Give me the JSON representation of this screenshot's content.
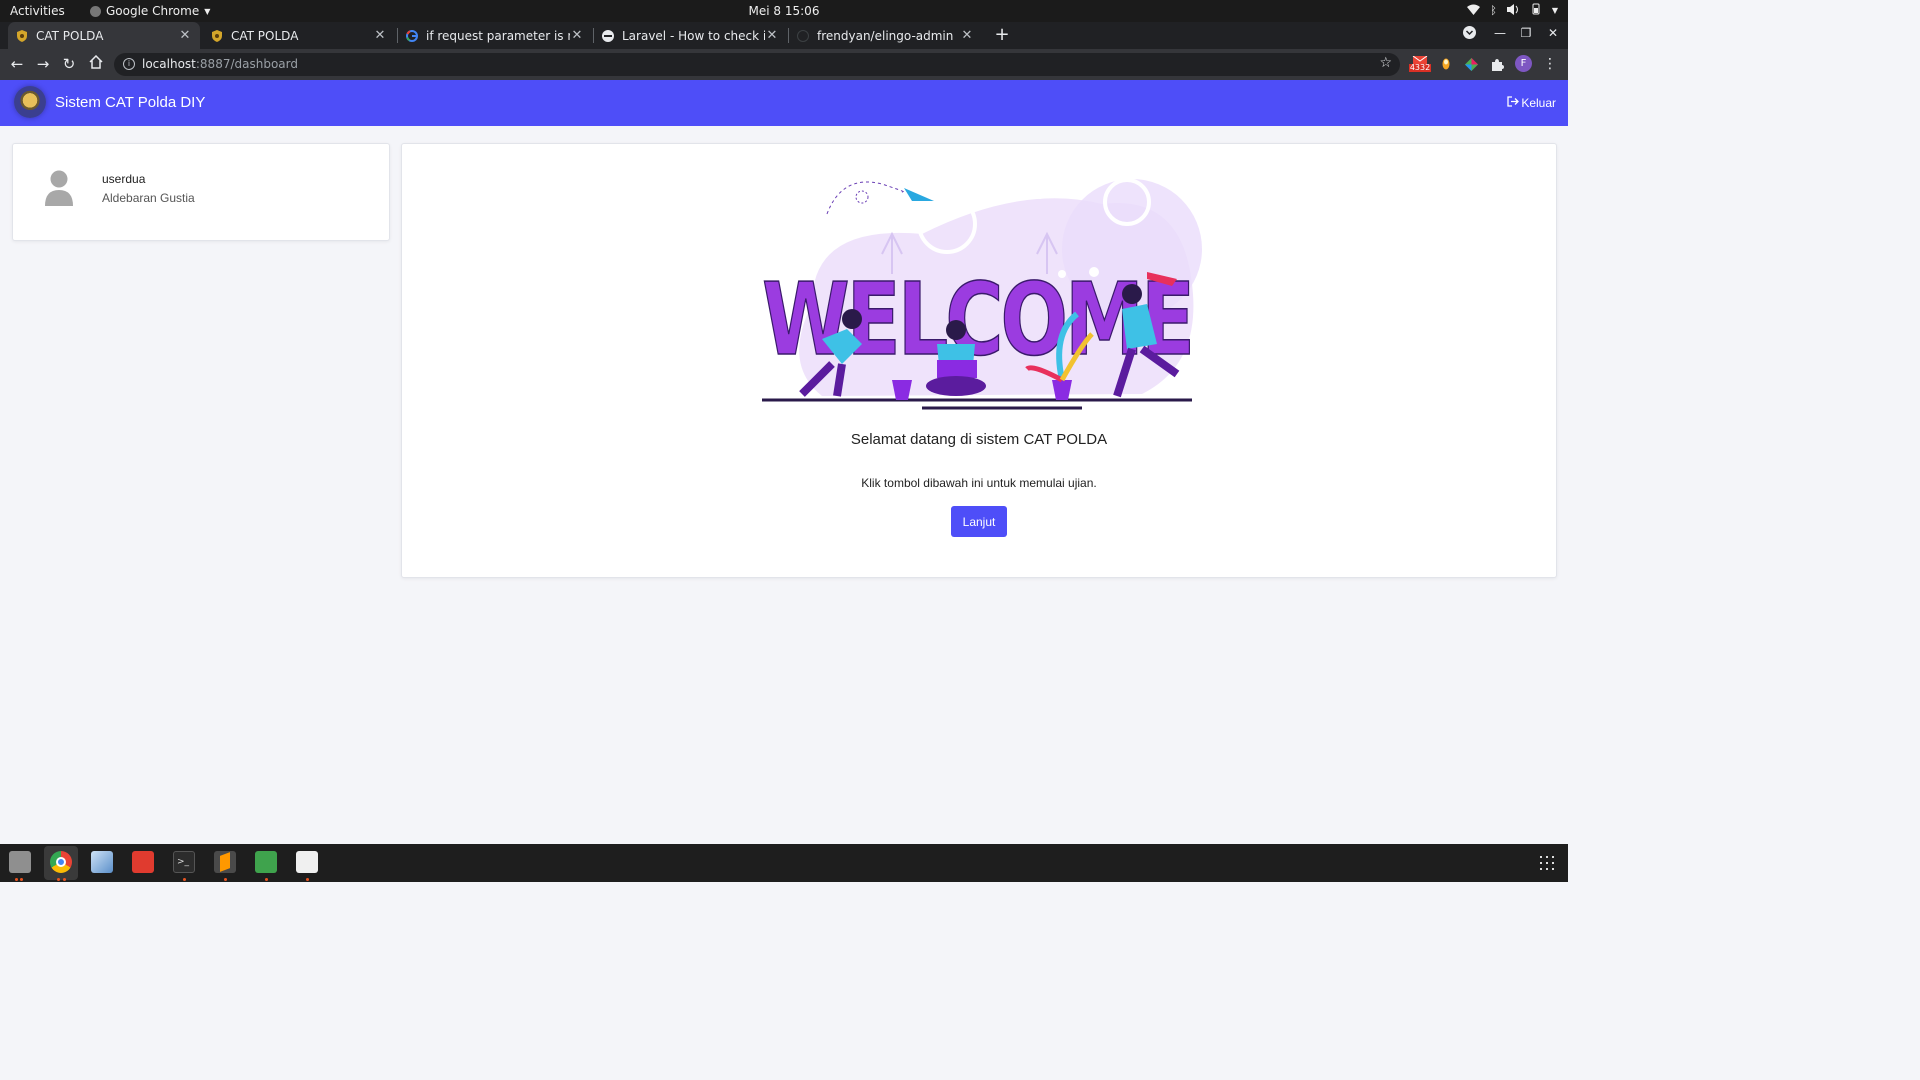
{
  "system_bar": {
    "activities": "Activities",
    "app_name": "Google Chrome",
    "clock": "Mei 8  15:06"
  },
  "browser": {
    "tabs": [
      {
        "title": "CAT POLDA",
        "icon": "police-badge-icon",
        "active": true
      },
      {
        "title": "CAT POLDA",
        "icon": "police-badge-icon",
        "active": false
      },
      {
        "title": "if request parameter is nu",
        "icon": "google-icon",
        "active": false
      },
      {
        "title": "Laravel - How to check if r",
        "icon": "laracasts-icon",
        "active": false
      },
      {
        "title": "frendyan/elingo-admin",
        "icon": "github-icon",
        "active": false
      }
    ],
    "url_host": "localhost",
    "url_path": ":8887/dashboard",
    "extension_badge": "4332",
    "profile_initial": "F"
  },
  "navbar": {
    "brand": "Sistem CAT Polda DIY",
    "logout_label": "Keluar"
  },
  "profile": {
    "username": "userdua",
    "full_name": "Aldebaran Gustia"
  },
  "welcome": {
    "illustration_text": "WELCOME",
    "title": "Selamat datang di sistem CAT POLDA",
    "subtitle": "Klik tombol dibawah ini untuk memulai ujian.",
    "button_label": "Lanjut"
  },
  "colors": {
    "primary": "#4e4ef8",
    "illustration_purple": "#8a2be2",
    "dock_indicator": "#e95420"
  }
}
